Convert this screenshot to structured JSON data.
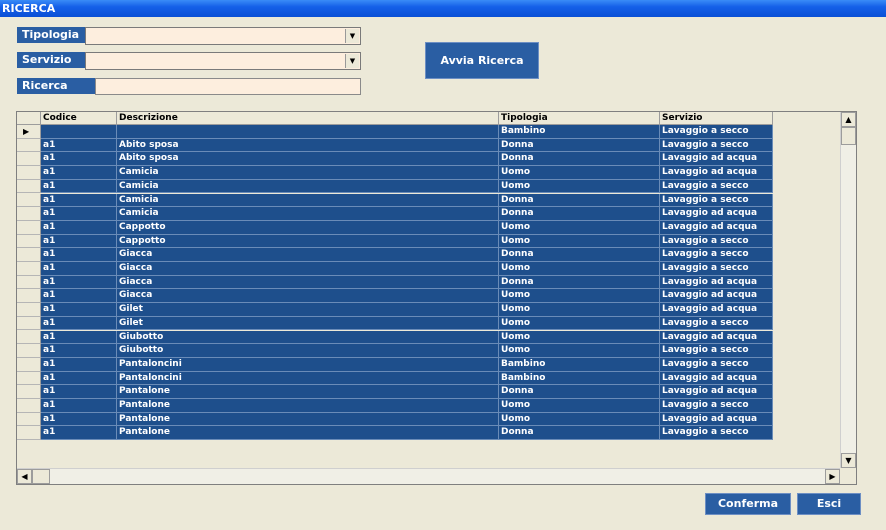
{
  "window": {
    "title": "RICERCA"
  },
  "filters": {
    "tipologia_label": "Tipologia",
    "tipologia_value": "",
    "servizio_label": "Servizio",
    "servizio_value": "",
    "ricerca_label": "Ricerca",
    "ricerca_value": ""
  },
  "buttons": {
    "avvia": "Avvia Ricerca",
    "conferma": "Conferma",
    "esci": "Esci"
  },
  "grid": {
    "columns": [
      "Codice",
      "Descrizione",
      "Tipologia",
      "Servizio"
    ],
    "rows": [
      [
        "",
        "",
        "Bambino",
        "Lavaggio a secco"
      ],
      [
        "a1",
        "Abito sposa",
        "Donna",
        "Lavaggio a secco"
      ],
      [
        "a1",
        "Abito sposa",
        "Donna",
        "Lavaggio ad acqua"
      ],
      [
        "a1",
        "Camicia",
        "Uomo",
        "Lavaggio ad acqua"
      ],
      [
        "a1",
        "Camicia",
        "Uomo",
        "Lavaggio a secco"
      ],
      [
        "a1",
        "Camicia",
        "Donna",
        "Lavaggio a secco"
      ],
      [
        "a1",
        "Camicia",
        "Donna",
        "Lavaggio ad acqua"
      ],
      [
        "a1",
        "Cappotto",
        "Uomo",
        "Lavaggio ad acqua"
      ],
      [
        "a1",
        "Cappotto",
        "Uomo",
        "Lavaggio a secco"
      ],
      [
        "a1",
        "Giacca",
        "Donna",
        "Lavaggio a secco"
      ],
      [
        "a1",
        "Giacca",
        "Uomo",
        "Lavaggio a secco"
      ],
      [
        "a1",
        "Giacca",
        "Donna",
        "Lavaggio ad acqua"
      ],
      [
        "a1",
        "Giacca",
        "Uomo",
        "Lavaggio ad acqua"
      ],
      [
        "a1",
        "Gilet",
        "Uomo",
        "Lavaggio ad acqua"
      ],
      [
        "a1",
        "Gilet",
        "Uomo",
        "Lavaggio a secco"
      ],
      [
        "a1",
        "Giubotto",
        "Uomo",
        "Lavaggio ad acqua"
      ],
      [
        "a1",
        "Giubotto",
        "Uomo",
        "Lavaggio a secco"
      ],
      [
        "a1",
        "Pantaloncini",
        "Bambino",
        "Lavaggio a secco"
      ],
      [
        "a1",
        "Pantaloncini",
        "Bambino",
        "Lavaggio ad acqua"
      ],
      [
        "a1",
        "Pantalone",
        "Donna",
        "Lavaggio ad acqua"
      ],
      [
        "a1",
        "Pantalone",
        "Uomo",
        "Lavaggio a secco"
      ],
      [
        "a1",
        "Pantalone",
        "Uomo",
        "Lavaggio ad acqua"
      ],
      [
        "a1",
        "Pantalone",
        "Donna",
        "Lavaggio a secco"
      ]
    ],
    "current_row_marker": "▶"
  },
  "colors": {
    "titlebar": "#0a4fd6",
    "cell_bg": "#1e4f8c",
    "label_bg": "#2a5ea3",
    "field_bg": "#fdeede"
  }
}
